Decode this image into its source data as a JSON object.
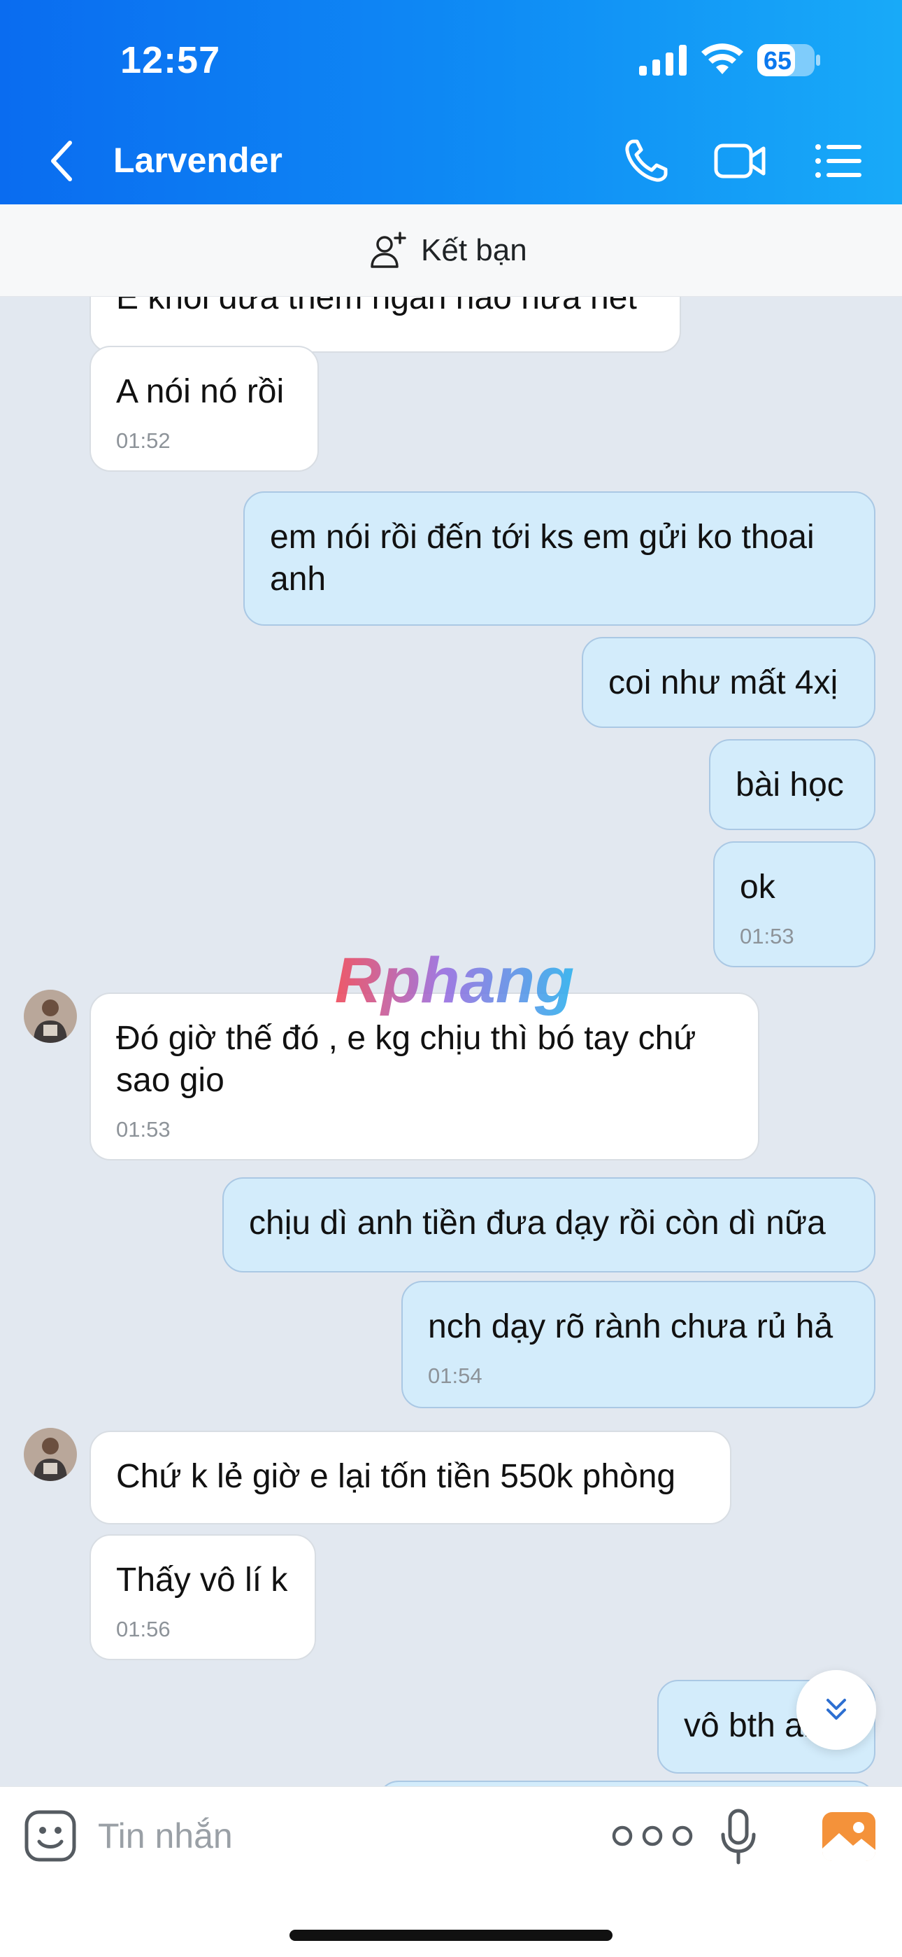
{
  "status_bar": {
    "time": "12:57",
    "battery": "65"
  },
  "header": {
    "contact_name": "Larvender"
  },
  "friend_bar": {
    "label": "Kết bạn"
  },
  "watermark": {
    "text": "Rphang"
  },
  "messages": [
    {
      "dir": "in",
      "text": "E khỏi đưa thêm ngàn nào nữa hết",
      "time": ""
    },
    {
      "dir": "in",
      "text": "A nói nó rồi",
      "time": "01:52"
    },
    {
      "dir": "out",
      "text": "em nói rồi đến tới ks em gửi ko thoai anh",
      "time": ""
    },
    {
      "dir": "out",
      "text": "coi như mất 4xị",
      "time": ""
    },
    {
      "dir": "out",
      "text": "bài học",
      "time": ""
    },
    {
      "dir": "out",
      "text": "ok",
      "time": "01:53"
    },
    {
      "dir": "in",
      "text": "Đó giờ thế đó , e kg chịu thì bó tay chứ sao gio",
      "time": "01:53"
    },
    {
      "dir": "out",
      "text": "chịu dì anh tiền đưa dạy rồi còn dì nữa",
      "time": ""
    },
    {
      "dir": "out",
      "text": "nch dạy rõ rành chưa rủ hả",
      "time": "01:54"
    },
    {
      "dir": "in",
      "text": "Chứ k lẻ giờ e lại tốn tiền 550k phòng",
      "time": ""
    },
    {
      "dir": "in",
      "text": "Thấy vô lí k",
      "time": "01:56"
    },
    {
      "dir": "out",
      "text": "vô bth anh",
      "time": ""
    }
  ],
  "composer": {
    "placeholder": "Tin nhắn"
  },
  "colors": {
    "header_start": "#0a6cf0",
    "header_end": "#18aaf8",
    "chat_bg": "#e2e8f0",
    "outgoing_bubble": "#d3ecfb",
    "incoming_bubble": "#ffffff",
    "image_icon": "#f4923a"
  },
  "icons": [
    "back-arrow-icon",
    "phone-icon",
    "video-call-icon",
    "menu-list-icon",
    "add-friend-icon",
    "sticker-icon",
    "more-dots-icon",
    "microphone-icon",
    "image-icon",
    "scroll-down-icon"
  ]
}
